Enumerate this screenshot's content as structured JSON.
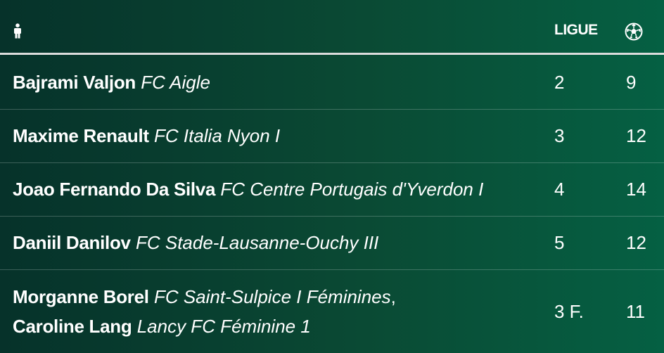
{
  "header": {
    "player_icon": "person-icon",
    "ligue_label": "LIGUE",
    "goals_icon": "soccer-ball-icon"
  },
  "rows": [
    {
      "players": [
        {
          "name": "Bajrami Valjon",
          "club": "FC Aigle"
        }
      ],
      "ligue": "2",
      "goals": "9"
    },
    {
      "players": [
        {
          "name": "Maxime Renault",
          "club": "FC Italia Nyon I"
        }
      ],
      "ligue": "3",
      "goals": "12"
    },
    {
      "players": [
        {
          "name": "Joao Fernando Da Silva",
          "club": "FC Centre Portugais d'Yverdon I"
        }
      ],
      "ligue": "4",
      "goals": "14"
    },
    {
      "players": [
        {
          "name": "Daniil Danilov",
          "club": "FC Stade-Lausanne-Ouchy III"
        }
      ],
      "ligue": "5",
      "goals": "12"
    },
    {
      "players": [
        {
          "name": "Morganne Borel",
          "club": "FC Saint-Sulpice I Féminines",
          "separator": ","
        },
        {
          "name": "Caroline Lang",
          "club": "Lancy FC Féminine 1"
        }
      ],
      "ligue": "3 F.",
      "goals": "11"
    }
  ]
}
